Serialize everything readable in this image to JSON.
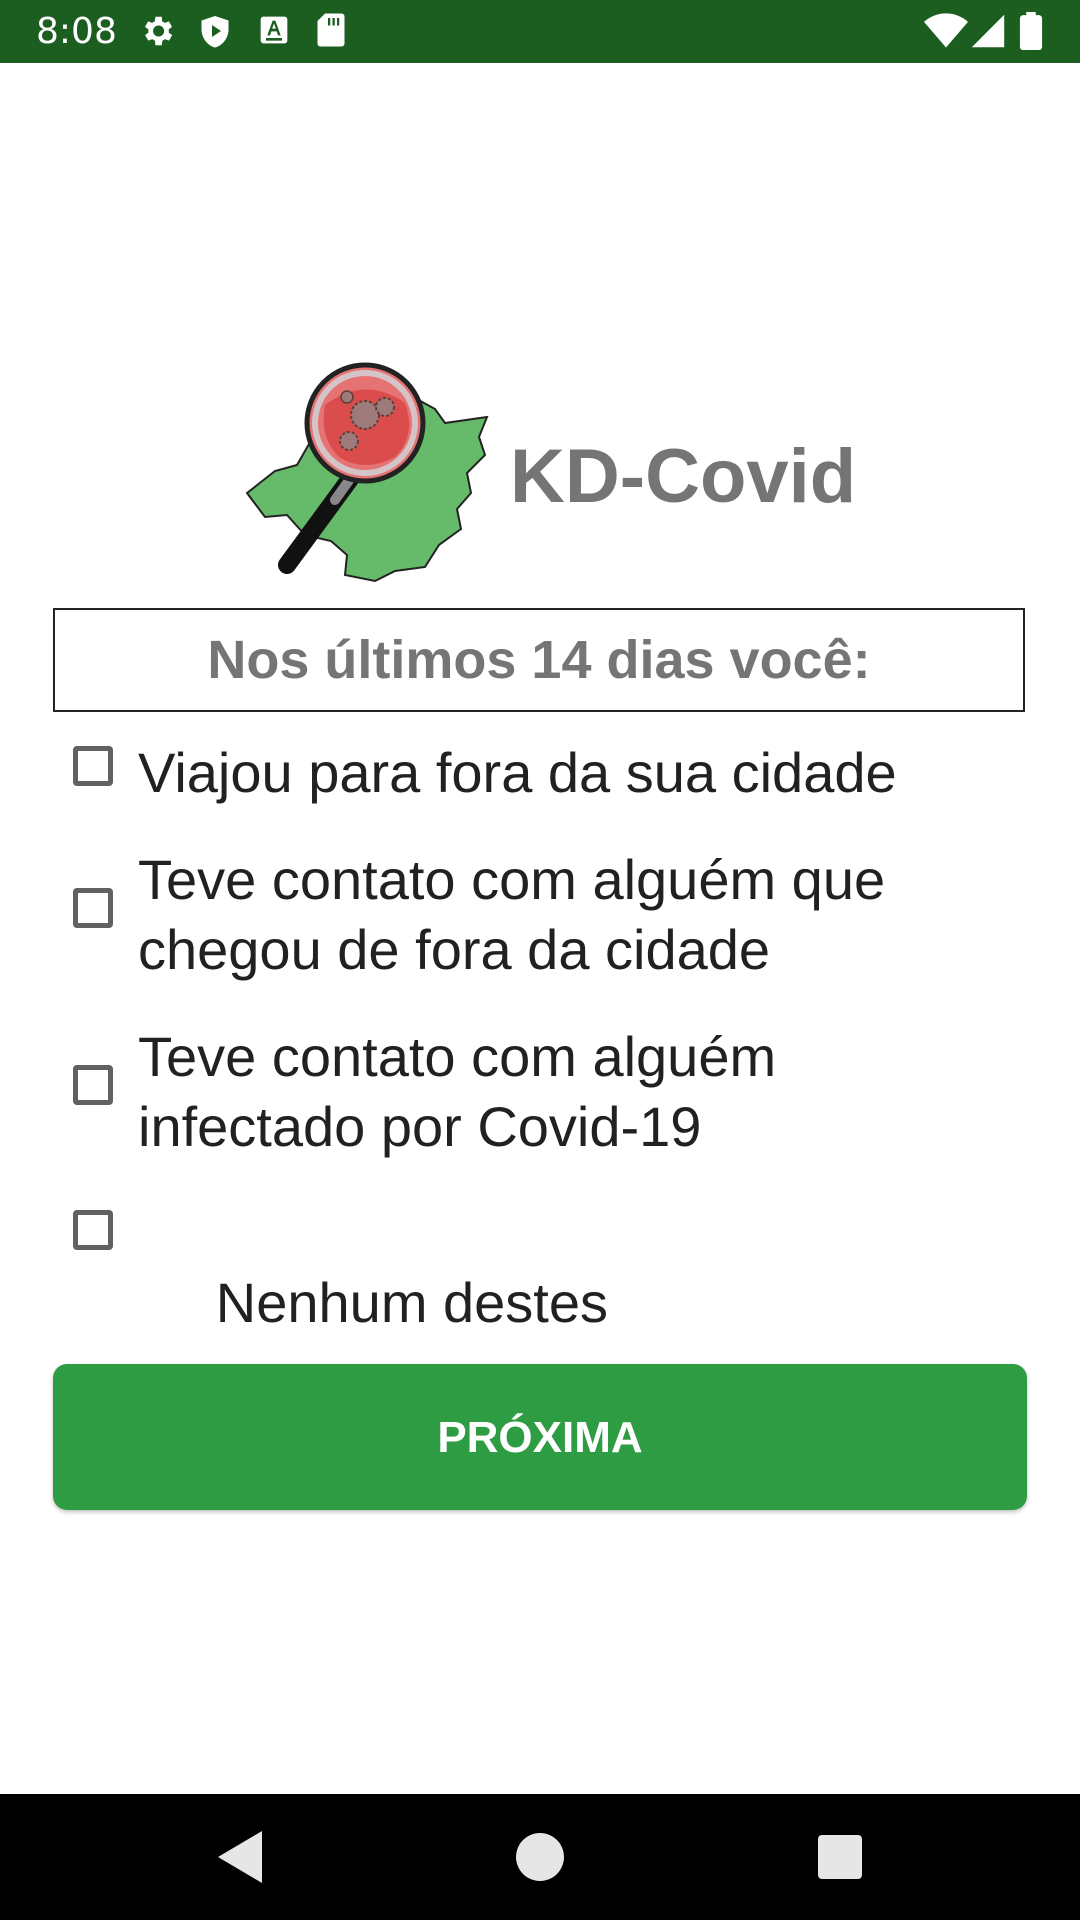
{
  "status_bar": {
    "time": "8:08",
    "left_icons": [
      "gear-icon",
      "shield-icon",
      "font-a-icon",
      "sd-card-icon"
    ],
    "right_icons": [
      "wifi-icon",
      "signal-icon",
      "battery-icon"
    ]
  },
  "header": {
    "logo": "magnifier-map-virus-logo",
    "app_title": "KD-Covid"
  },
  "question": {
    "text": "Nos últimos 14 dias você:"
  },
  "options": [
    {
      "label_lines": [
        "Viajou para fora da sua cidade"
      ],
      "checked": false
    },
    {
      "label_lines": [
        "Teve contato com alguém que",
        "chegou de fora da cidade"
      ],
      "checked": false
    },
    {
      "label_lines": [
        "Teve contato com alguém",
        "infectado por Covid-19"
      ],
      "checked": false
    },
    {
      "label_lines": [
        " Nenhum destes"
      ],
      "checked": false
    }
  ],
  "next_button": {
    "label": "PRÓXIMA"
  },
  "nav_bar": {
    "buttons": [
      "back-icon",
      "home-icon",
      "recents-icon"
    ]
  },
  "colors": {
    "status_bar": "#1b5e20",
    "button": "#2e9c42",
    "title_gray": "#757575",
    "nav_bar": "#000000"
  }
}
